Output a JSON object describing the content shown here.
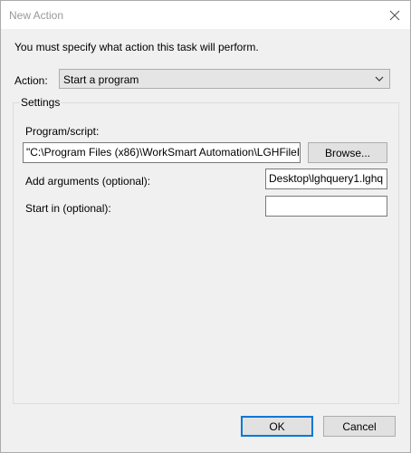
{
  "window": {
    "title": "New Action"
  },
  "instruction": "You must specify what action this task will perform.",
  "action": {
    "label": "Action:",
    "selected": "Start a program"
  },
  "settings": {
    "legend": "Settings",
    "program_label": "Program/script:",
    "program_value": "\"C:\\Program Files (x86)\\WorkSmart Automation\\LGHFileI",
    "browse_label": "Browse...",
    "args_label": "Add arguments (optional):",
    "args_value": "Desktop\\lghquery1.lghq",
    "start_label": "Start in (optional):",
    "start_value": ""
  },
  "buttons": {
    "ok": "OK",
    "cancel": "Cancel"
  },
  "icons": {
    "close": "close-icon",
    "dropdown": "chevron-down-icon"
  }
}
